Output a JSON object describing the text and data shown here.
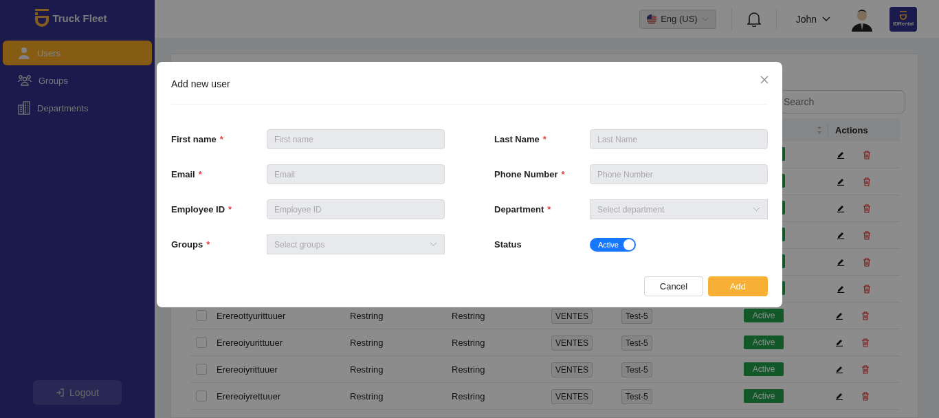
{
  "sidebar": {
    "brand": "Truck Fleet",
    "items": [
      {
        "label": "Users",
        "selected": true
      },
      {
        "label": "Groups",
        "selected": false
      },
      {
        "label": "Departments",
        "selected": false
      }
    ],
    "logout": "Logout"
  },
  "header": {
    "language": "Eng (US)",
    "user": "John",
    "logo_text": "IDRental"
  },
  "content": {
    "search": {
      "placeholder": "Search"
    },
    "table": {
      "columns": [
        {
          "label": "Actions"
        }
      ],
      "rows": [
        {
          "kind": "covered"
        },
        {
          "kind": "covered"
        },
        {
          "kind": "covered"
        },
        {
          "kind": "covered"
        },
        {
          "kind": "covered"
        },
        {
          "kind": "covered"
        },
        {
          "kind": "full",
          "name": "Erereottyurittuuer",
          "column_3": "Restring",
          "column_4": "Restring",
          "tag_1": "VENTES",
          "tag_2": "Test-5",
          "status": "Active",
          "checked": false
        },
        {
          "kind": "full",
          "name": "Erereoiyurittuuer",
          "column_3": "Restring",
          "column_4": "Restring",
          "tag_1": "VENTES",
          "tag_2": "Test-5",
          "status": "Active",
          "checked": false
        },
        {
          "kind": "full",
          "name": "Erereoiyrittuuer",
          "column_3": "Restring",
          "column_4": "Restring",
          "tag_1": "VENTES",
          "tag_2": "Test-5",
          "status": "Active",
          "checked": false
        },
        {
          "kind": "full",
          "name": "Erereoiyrettuuer",
          "column_3": "Restring",
          "column_4": "Restring",
          "tag_1": "VENTES",
          "tag_2": "Test-5",
          "status": "Active",
          "checked": false
        }
      ]
    }
  },
  "dialog": {
    "title": "Add new user",
    "fields": [
      {
        "kind": "input",
        "label": "First name",
        "required_mark": "*",
        "placeholder": "First name"
      },
      {
        "kind": "input",
        "label": "Last Name",
        "required_mark": "*",
        "placeholder": "Last Name"
      },
      {
        "kind": "input",
        "label": "Email",
        "required_mark": "*",
        "placeholder": "Email"
      },
      {
        "kind": "input",
        "label": "Phone Number",
        "required_mark": "*",
        "placeholder": "Phone Number"
      },
      {
        "kind": "input",
        "label": "Employee ID",
        "required_mark": "*",
        "placeholder": "Employee ID"
      },
      {
        "kind": "select",
        "label": "Department",
        "required_mark": "*",
        "placeholder": "Select department"
      },
      {
        "kind": "select",
        "label": "Groups",
        "required_mark": "*",
        "placeholder": "Select groups"
      },
      {
        "kind": "toggle",
        "label": "Status",
        "on": true,
        "text": "Active"
      }
    ],
    "buttons": [
      {
        "label": "Cancel",
        "primary": false
      },
      {
        "label": "Add",
        "primary": true
      }
    ]
  }
}
